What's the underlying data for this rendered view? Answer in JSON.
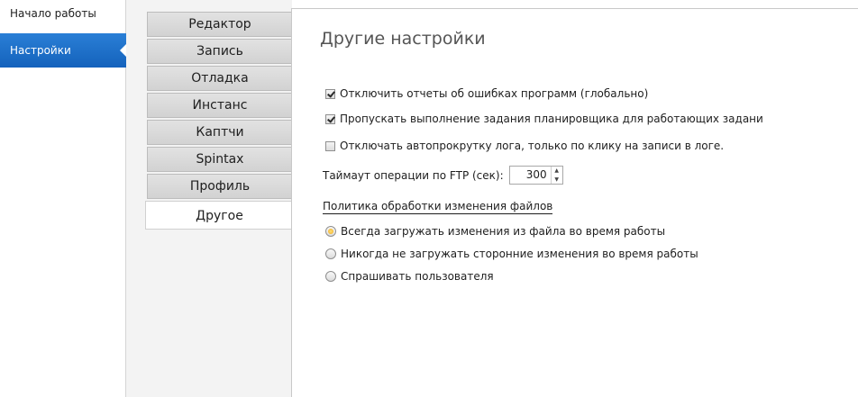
{
  "nav": {
    "items": [
      {
        "label": "Начало работы"
      },
      {
        "label": "Настройки"
      }
    ]
  },
  "tabs": [
    {
      "label": "Редактор"
    },
    {
      "label": "Запись"
    },
    {
      "label": "Отладка"
    },
    {
      "label": "Инстанс"
    },
    {
      "label": "Каптчи"
    },
    {
      "label": "Spintax"
    },
    {
      "label": "Профиль"
    },
    {
      "label": "Другое"
    }
  ],
  "content": {
    "title": "Другие настройки",
    "checkboxes": [
      {
        "label": "Отключить отчеты об ошибках программ (глобально)",
        "checked": true
      },
      {
        "label": "Пропускать выполнение задания планировщика для работающих задани",
        "checked": true
      },
      {
        "label": "Отключать автопрокрутку лога, только по клику на записи в логе.",
        "checked": false
      }
    ],
    "ftp": {
      "label": "Таймаут операции по FTP (сек):",
      "value": "300",
      "up_icon": "▲",
      "down_icon": "▼"
    },
    "policy": {
      "title": "Политика обработки изменения файлов",
      "options": [
        {
          "label": "Всегда загружать изменения из файла во время работы",
          "selected": true
        },
        {
          "label": "Никогда не загружать сторонние изменения во время работы",
          "selected": false
        },
        {
          "label": "Спрашивать пользователя",
          "selected": false
        }
      ]
    }
  }
}
